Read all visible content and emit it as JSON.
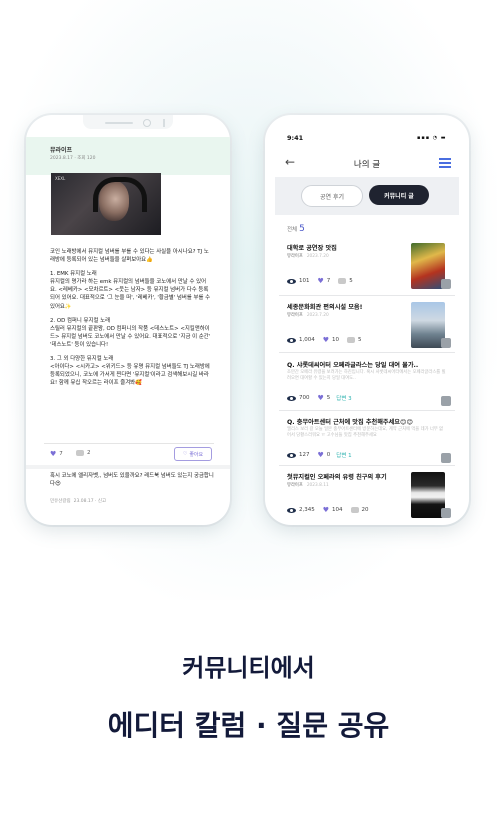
{
  "left_phone": {
    "category": "뮤라이프",
    "date_line": "2023.8.17 · 조회 120",
    "video_tag": "XEXL",
    "paragraphs": [
      "코인 노래방에서 뮤지컬 넘버를 부를 수 있다는 사실을 아시나요? TJ 노래방에 등록되어 있는 넘버들을 살펴보아요👍",
      "1. EMK 뮤지컬 노래\n뮤지컬의 명가라 하는 emk 뮤지컬의 넘버들을 코노에서 만날 수 있어요. <레베카> <모차르트> <웃는 남자> 등 뮤지컬 넘버가 다수 등록되어 있어요. 대표적으로 '그 눈을 떠', '레베카', '황금별' 넘버를 부를 수 있어요✨",
      "2. OD 컴퍼니 뮤지컬 노래\n스릴러 뮤지컬의 끝판왕, OD 컴퍼니의 작품 <데스노트> <지킬앤하이드> 뮤지컬 넘버도 코노에서 만날 수 있어요. 대표적으로 '지금 이 순간' '데스노트' 등이 있습니다!",
      "3. 그 외 다양한 뮤지컬 노래\n<아이다> <시카고> <위키드> 등 유명 뮤지컬 넘버들도 TJ 노래방에 등록되었으니, 코노에 가서게 찐다면 '뮤지컬'이라고 검색해보시길 바라요! 함께 뮤십 작오르는 라이프 즐겨봐🥰"
    ],
    "likes": "7",
    "comments": "2",
    "like_button": "좋아요",
    "comment_text": "혹시 코노에 엘리자벳,, 넘버도 있을까요? 레드북 넘버도 있는지 궁금합니다😍",
    "comment_author": "민유산갈림",
    "comment_meta": "23.08.17 · 신고"
  },
  "right_phone": {
    "time": "9:41",
    "status_icons": "▪▪▪ ◔ ▬",
    "page_title": "나의 글",
    "tabs": [
      "공연 후기",
      "커뮤니티 글"
    ],
    "total_label": "전체",
    "total_count": "5",
    "items": [
      {
        "title": "대학로 공연장 맛집",
        "category": "뮤라이프",
        "date": "2023.7.20",
        "views": "101",
        "likes": "7",
        "comments": "5",
        "answer": ""
      },
      {
        "title": "세종문화회관 편의시설 모음!",
        "category": "뮤라이프",
        "date": "2023.7.20",
        "views": "1,004",
        "likes": "10",
        "comments": "5",
        "answer": ""
      },
      {
        "title": "Q. 샤롯데씨어터 오페라글라스는 당일 대여 물가..",
        "excerpt": "조만간 오페라 유령을 보려가는 하진입니다. 혹시 샤롯데씨어터에서는 오페라글라스를 빌려오면 대여할 수 있는지 당일 대여도..",
        "views": "700",
        "likes": "5",
        "answer": "답변 3"
      },
      {
        "title": "Q. 충무아트센터 근처에 맛집 추천해주세요😊😊",
        "excerpt": "엘리스 보러 갈 오늘 일본 충무아트센터에 방문하는데요, 계약 근처에 먹을 데가 너무 없어서 당황스러워요 ㅠ 고수님들 맛집 추천해주세요",
        "views": "127",
        "likes": "0",
        "answer": "답변 1"
      },
      {
        "title": "첫뮤지컬인 오페라의 유령 친구의 후기",
        "category": "뮤라이프",
        "date": "2023.8.11",
        "views": "2,345",
        "likes": "104",
        "comments": "20",
        "answer": ""
      }
    ]
  },
  "headline": {
    "line1": "커뮤니티에서",
    "line2": "에디터 칼럼 · 질문 공유"
  }
}
